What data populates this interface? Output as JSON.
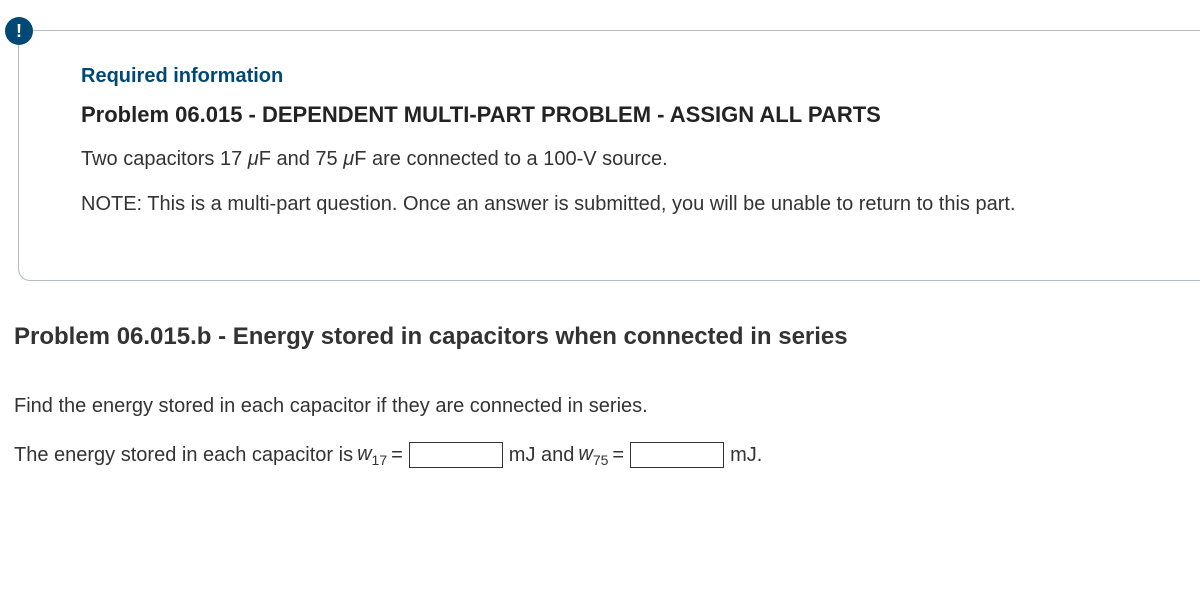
{
  "badge": "!",
  "requiredLabel": "Required information",
  "problemTitle": "Problem 06.015 - DEPENDENT MULTI-PART PROBLEM - ASSIGN ALL PARTS",
  "desc": {
    "pre": "Two capacitors 17 ",
    "unit1": "μ",
    "mid1": "F and 75 ",
    "unit2": "μ",
    "post": "F are connected to a 100-V source."
  },
  "note": "NOTE: This is a multi-part question. Once an answer is submitted, you will be unable to return to this part.",
  "sub": {
    "title": "Problem 06.015.b - Energy stored in capacitors when connected in series",
    "find": "Find the energy stored in each capacitor if they are connected in series.",
    "ans": {
      "lead": "The energy stored in each capacitor is ",
      "var1": "w",
      "sub1": "17",
      "eq1": " = ",
      "unit1": " mJ and ",
      "var2": "w",
      "sub2": "75",
      "eq2": " = ",
      "unit2": " mJ."
    },
    "inputs": {
      "w17": "",
      "w75": ""
    }
  }
}
